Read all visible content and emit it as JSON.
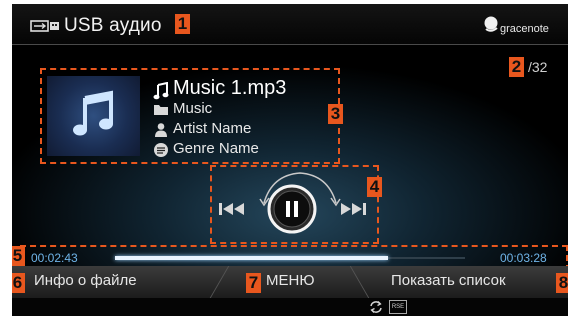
{
  "header": {
    "title": "USB аудио",
    "usb_icon": "usb-icon",
    "brand": "gracenote",
    "track_counter_suffix": "/32"
  },
  "badges": [
    "1",
    "2",
    "3",
    "4",
    "5",
    "6",
    "7",
    "8"
  ],
  "track": {
    "song": "Music 1.mp3",
    "folder": "Music",
    "artist": "Artist Name",
    "genre": "Genre Name"
  },
  "controls": {
    "prev_icon": "skip-previous-icon",
    "pause_icon": "pause-icon",
    "next_icon": "skip-next-icon"
  },
  "progress": {
    "elapsed": "00:02:43",
    "total": "00:03:28",
    "fraction": 0.78
  },
  "menu": {
    "file_info": "Инфо о файле",
    "menu": "МЕНЮ",
    "show_list": "Показать список"
  },
  "status": {
    "repeat_icon": "repeat-icon",
    "rse_label": "RSE"
  },
  "colors": {
    "accent_orange": "#e8571e",
    "progress_blue": "#6fb4e8",
    "background": "#000000"
  }
}
